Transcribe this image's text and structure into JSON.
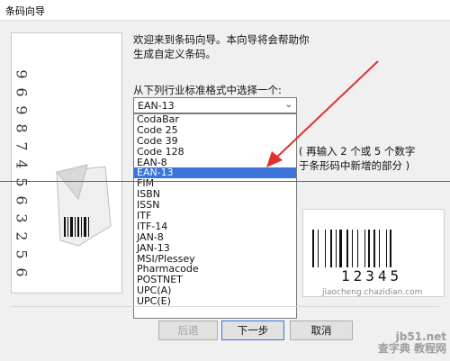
{
  "window": {
    "title": "条码向导"
  },
  "intro": {
    "line1": "欢迎来到条码向导。本向导将会帮助你",
    "line2": "生成自定义条码。"
  },
  "prompt": "从下列行业标准格式中选择一个:",
  "select": {
    "value": "EAN-13"
  },
  "list": {
    "items": [
      "CodaBar",
      "Code 25",
      "Code 39",
      "Code 128",
      "EAN-8",
      "EAN-13",
      "FIM",
      "ISBN",
      "ISSN",
      "ITF",
      "ITF-14",
      "JAN-8",
      "JAN-13",
      "MSI/Plessey",
      "Pharmacode",
      "POSTNET",
      "UPC(A)",
      "UPC(E)"
    ],
    "selected_index": 5
  },
  "hint": {
    "line1": "( 再输入 2 个或 5 个数字",
    "line2": "于条形码中新增的部分 )"
  },
  "sample": {
    "digits": "12345"
  },
  "left_graphic": {
    "digits": [
      "6",
      "5",
      "2",
      "3",
      "6",
      "5",
      "4",
      "7",
      "8",
      "9",
      "6",
      "9"
    ]
  },
  "buttons": {
    "back": "后退",
    "next": "下一步",
    "cancel": "取消"
  },
  "watermark": {
    "site": "jb51.net",
    "brand": "查字典 教程网",
    "url": "jiaocheng.chazidian.com"
  },
  "colors": {
    "selection": "#3a74d9",
    "annotation": "#e03030"
  }
}
